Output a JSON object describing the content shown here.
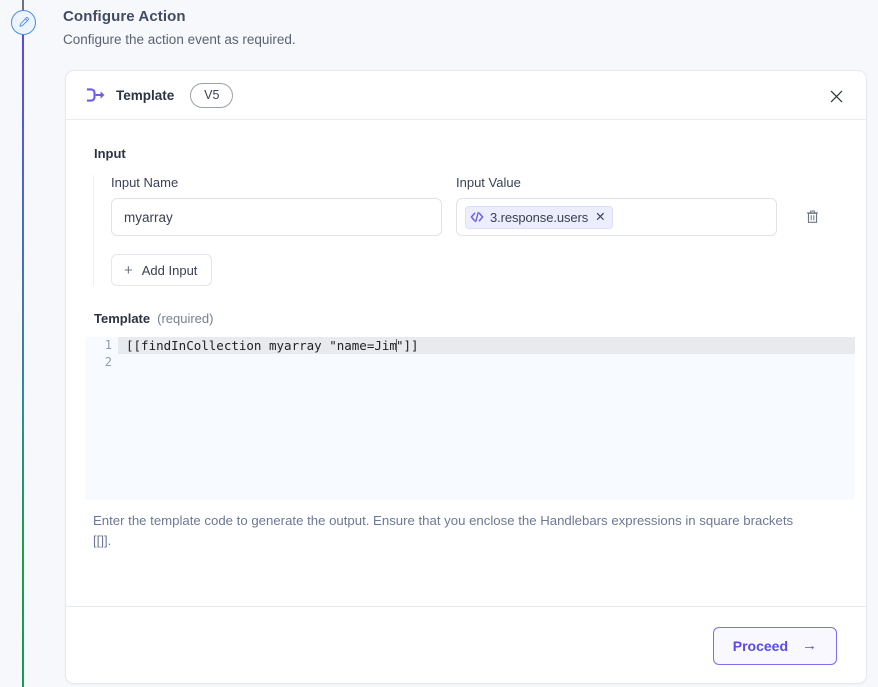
{
  "timeline": {
    "node_icon": "pencil-icon",
    "line_gradient_start": "#5b4ae4",
    "line_gradient_end": "#0f9d58"
  },
  "page": {
    "title": "Configure Action",
    "subtitle": "Configure the action event as required."
  },
  "card": {
    "header": {
      "icon": "template-branch-icon",
      "title": "Template",
      "version_badge": "V5",
      "close_icon": "close-icon"
    },
    "input_section": {
      "label": "Input",
      "columns": {
        "name": "Input Name",
        "value": "Input Value"
      },
      "rows": [
        {
          "name_value": "myarray",
          "name_placeholder": "Input Name",
          "chip": {
            "icon": "code-icon",
            "label": "3.response.users",
            "remove_icon": "✕"
          },
          "delete_icon": "trash-icon"
        }
      ],
      "add_input": {
        "icon": "plus-icon",
        "label": "Add Input"
      }
    },
    "template_section": {
      "label": "Template",
      "required_hint": "(required)",
      "editor": {
        "line_numbers": [
          "1",
          "2"
        ],
        "lines": [
          "[[findInCollection myarray \"name=Jim\"]]",
          ""
        ],
        "code_before_caret": "[[findInCollection myarray \"name=Jim",
        "code_after_caret": "\"]]",
        "active_line": 1,
        "background": "#f7faff",
        "active_line_background": "#e8eaed"
      },
      "help_text": "Enter the template code to generate the output. Ensure that you enclose the Handlebars expressions in square brackets [[]]."
    },
    "footer": {
      "proceed_label": "Proceed",
      "proceed_arrow": "→",
      "accent_color": "#5b4ae4"
    }
  }
}
